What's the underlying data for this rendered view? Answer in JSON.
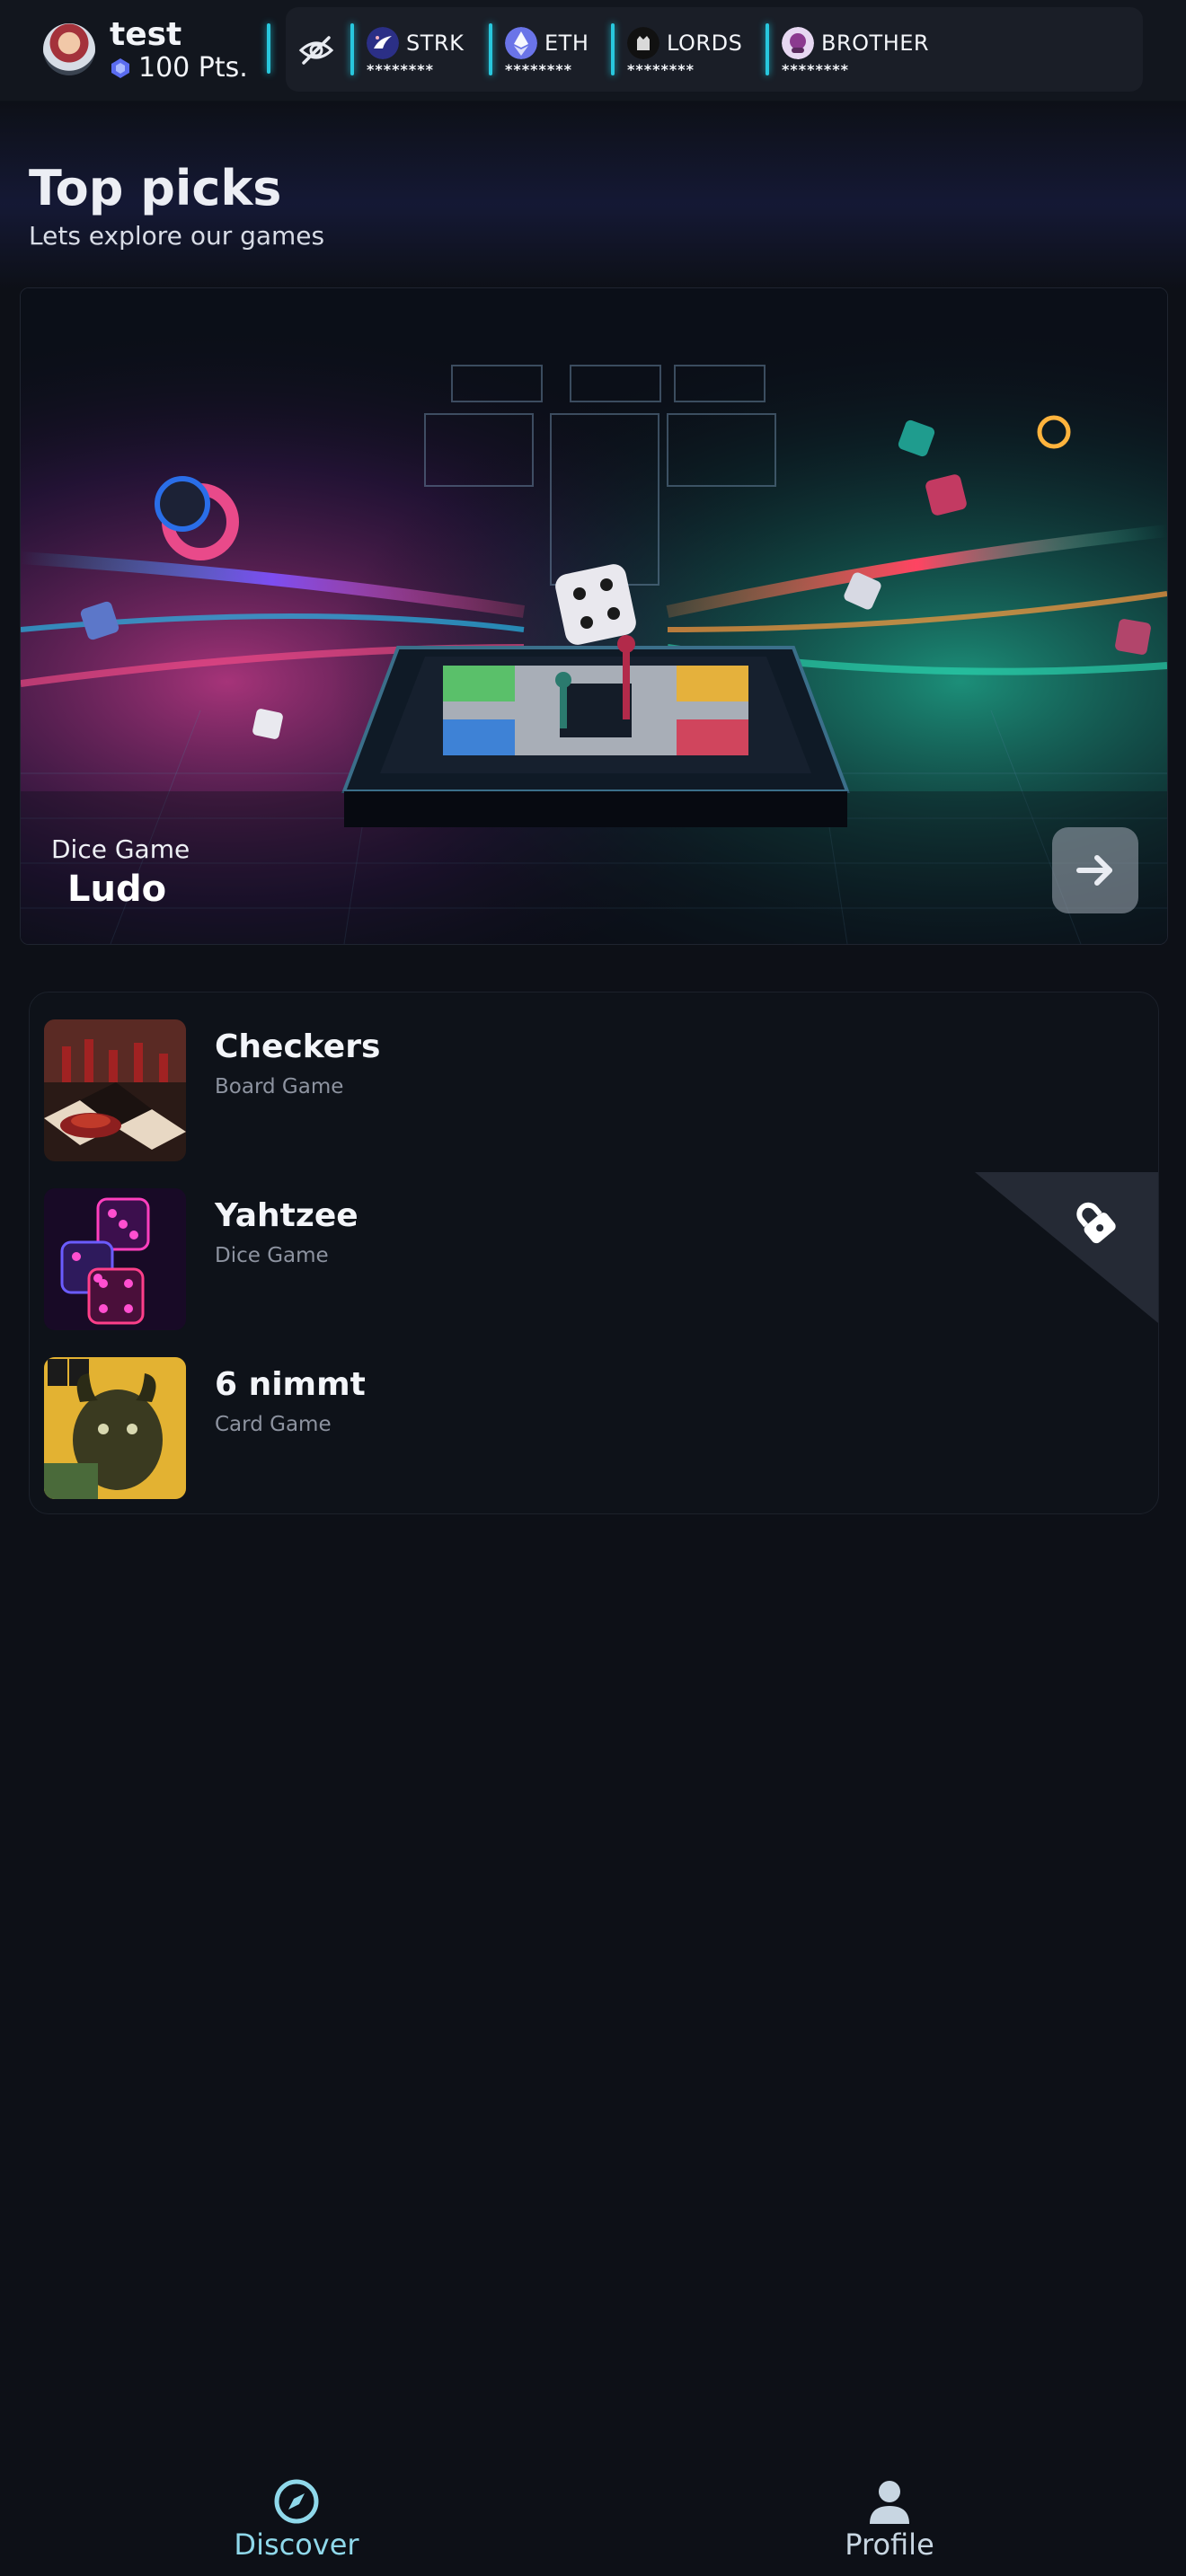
{
  "header": {
    "username": "test",
    "points": "100 Pts.",
    "balances": [
      {
        "name": "STRK",
        "value": "********",
        "icon": "strk-logo",
        "color": "#2b2f86"
      },
      {
        "name": "ETH",
        "value": "********",
        "icon": "eth-logo",
        "color": "#6a74e8"
      },
      {
        "name": "LORDS",
        "value": "********",
        "icon": "lords-logo",
        "color": "#111111"
      },
      {
        "name": "BROTHER",
        "value": "********",
        "icon": "brother-logo",
        "color": "#e7d8f2"
      }
    ]
  },
  "top_picks": {
    "title": "Top picks",
    "subtitle": "Lets explore our games",
    "featured": {
      "category": "Dice Game",
      "name": "Ludo"
    }
  },
  "games": [
    {
      "name": "Checkers",
      "category": "Board Game",
      "locked": false
    },
    {
      "name": "Yahtzee",
      "category": "Dice Game",
      "locked": true
    },
    {
      "name": "6 nimmt",
      "category": "Card Game",
      "locked": false
    }
  ],
  "nav": {
    "items": [
      {
        "label": "Discover",
        "icon": "compass-icon",
        "active": true
      },
      {
        "label": "Profile",
        "icon": "person-icon",
        "active": false
      }
    ]
  },
  "colors": {
    "background": "#0d1017",
    "accent": "#28c7dd",
    "nav_active": "#8fd8ea",
    "nav_inactive": "#c8d6e2"
  }
}
